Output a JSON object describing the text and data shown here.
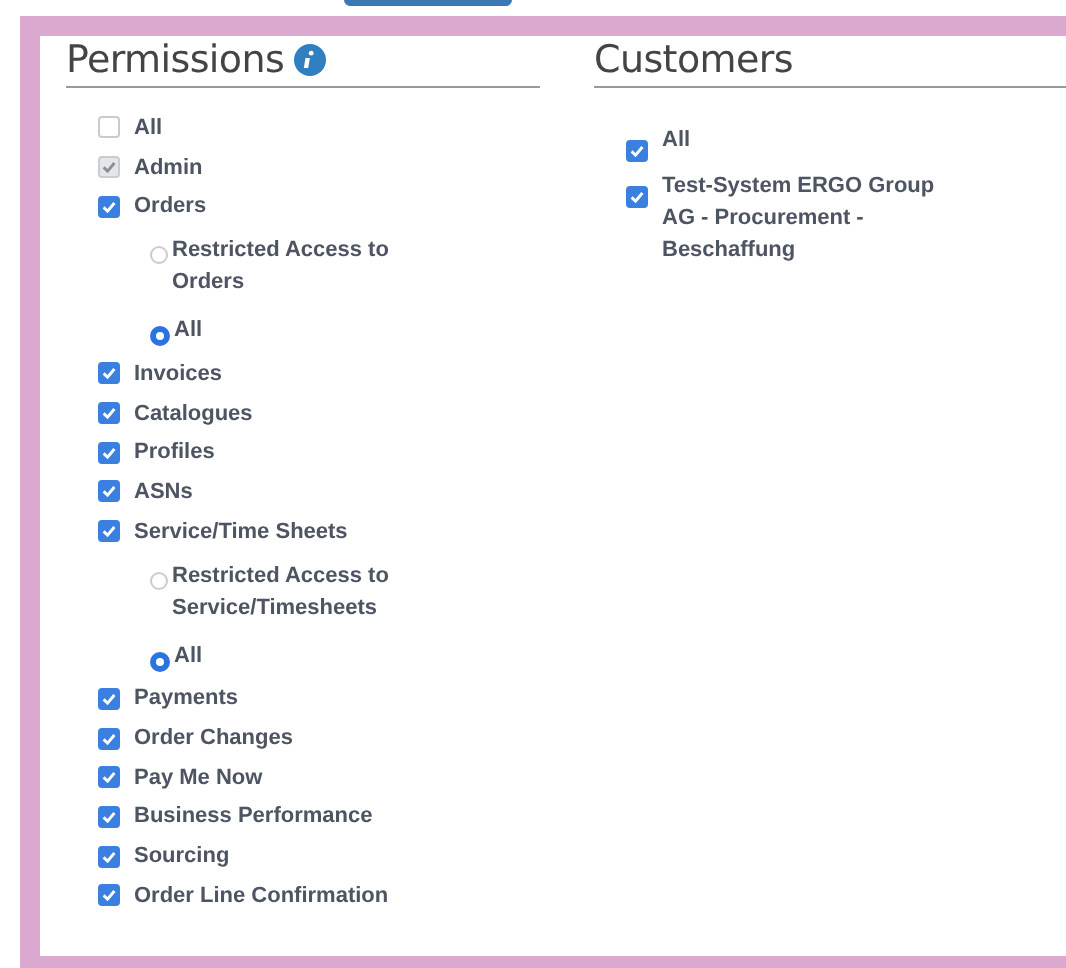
{
  "permissions": {
    "title": "Permissions",
    "items": [
      {
        "label": "All",
        "checked": false,
        "disabled": false
      },
      {
        "label": "Admin",
        "checked": true,
        "disabled": true
      },
      {
        "label": "Orders",
        "checked": true,
        "disabled": false,
        "options": [
          {
            "label": "Restricted Access to Orders",
            "selected": false
          },
          {
            "label": "All",
            "selected": true
          }
        ]
      },
      {
        "label": "Invoices",
        "checked": true,
        "disabled": false
      },
      {
        "label": "Catalogues",
        "checked": true,
        "disabled": false
      },
      {
        "label": "Profiles",
        "checked": true,
        "disabled": false
      },
      {
        "label": "ASNs",
        "checked": true,
        "disabled": false
      },
      {
        "label": "Service/Time Sheets",
        "checked": true,
        "disabled": false,
        "options": [
          {
            "label": "Restricted Access to Service/Timesheets",
            "selected": false
          },
          {
            "label": "All",
            "selected": true
          }
        ]
      },
      {
        "label": "Payments",
        "checked": true,
        "disabled": false
      },
      {
        "label": "Order Changes",
        "checked": true,
        "disabled": false
      },
      {
        "label": "Pay Me Now",
        "checked": true,
        "disabled": false
      },
      {
        "label": "Business Performance",
        "checked": true,
        "disabled": false
      },
      {
        "label": "Sourcing",
        "checked": true,
        "disabled": false
      },
      {
        "label": "Order Line Confirmation",
        "checked": true,
        "disabled": false
      }
    ]
  },
  "customers": {
    "title": "Customers",
    "items": [
      {
        "label": "All",
        "checked": true
      },
      {
        "label": "Test-System ERGO Group AG - Procurement - Beschaffung",
        "checked": true
      }
    ]
  }
}
